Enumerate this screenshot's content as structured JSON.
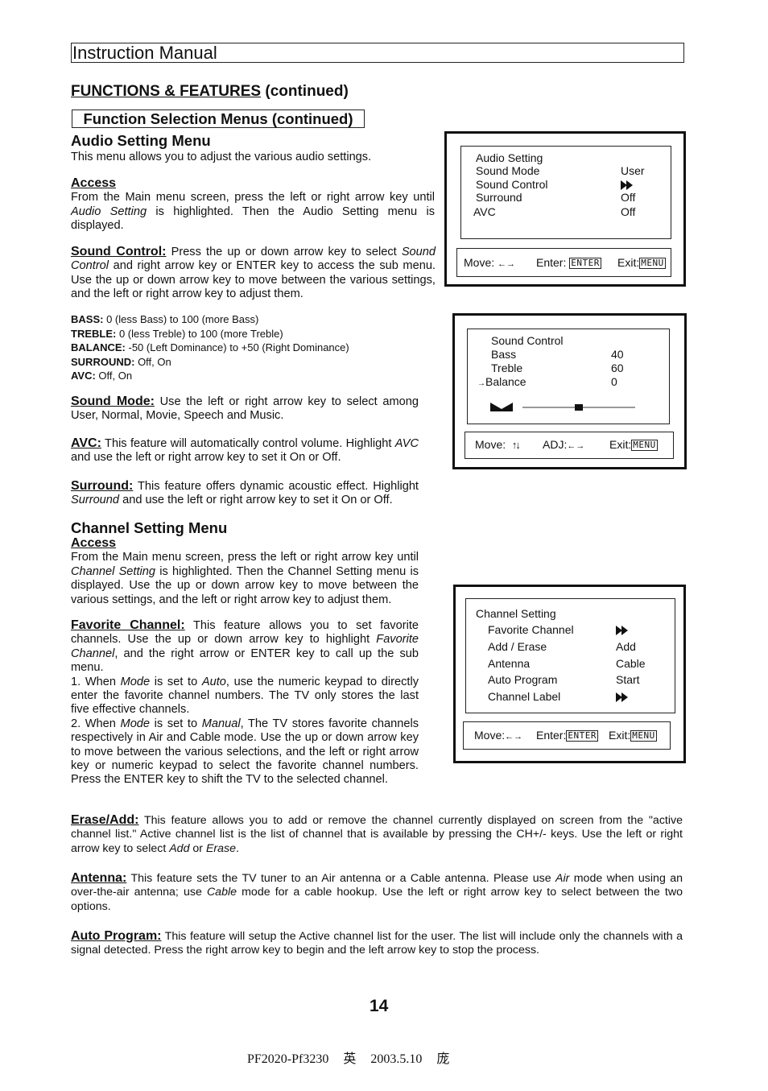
{
  "header": {
    "title": "Instruction Manual"
  },
  "section": {
    "title_underlined": "FUNCTIONS & FEATURES",
    "title_suffix": " (continued)",
    "subtitle": "Function Selection Menus (continued)"
  },
  "audio": {
    "heading": "Audio Setting Menu",
    "intro": "This menu allows you to adjust the various audio settings.",
    "access_label": "Access",
    "access_p1": "From the Main menu screen, press the left or right arrow key until ",
    "access_i1": "Audio Setting",
    "access_p2": " is highlighted. Then the Audio Setting menu is displayed.",
    "sound_control_label": "Sound Control:",
    "sound_control_p1": " Press the up or down arrow key to select ",
    "sound_control_i1": "Sound Control",
    "sound_control_p2": " and right arrow key or ENTER key to access the sub menu. Use the up or down arrow key to move between the various settings, and the left or right arrow key to adjust them.",
    "specs": [
      {
        "key": "BASS:",
        "value": " 0 (less Bass) to 100 (more Bass)"
      },
      {
        "key": "TREBLE:",
        "value": " 0 (less Treble) to 100 (more Treble)"
      },
      {
        "key": "BALANCE:",
        "value": " -50 (Left Dominance) to +50 (Right Dominance)"
      },
      {
        "key": "SURROUND:",
        "value": " Off, On"
      },
      {
        "key": "AVC:",
        "value": " Off, On"
      }
    ],
    "sound_mode_label": "Sound Mode:",
    "sound_mode_text": " Use the left or right arrow key to select among User, Normal, Movie, Speech and Music.",
    "avc_label": "AVC:",
    "avc_p1": " This feature will automatically control volume. Highlight ",
    "avc_i1": "AVC",
    "avc_p2": " and use the left or right arrow key to set it On or Off.",
    "surround_label": "Surround:",
    "surround_p1": " This feature offers dynamic acoustic effect. Highlight ",
    "surround_i1": "Surround",
    "surround_p2": " and use the left or right arrow key to set it On or Off."
  },
  "channel": {
    "heading": "Channel Setting Menu",
    "access_label": "Access",
    "access_p1": "From the Main menu screen, press the left or right arrow key until ",
    "access_i1": "Channel Setting",
    "access_p2": " is highlighted. Then the Channel Setting menu is displayed. Use the up or down arrow key to move between the various settings, and the left or right arrow key to adjust them.",
    "fav_label": "Favorite Channel",
    "fav_colon": ":",
    "fav_p1": " This feature allows you to set favorite channels. Use the up or down arrow key to highlight ",
    "fav_i1": "Favorite Channel",
    "fav_p2": ", and the right arrow or ENTER key to call up the sub menu.",
    "fav_n1_a": "1. When ",
    "fav_n1_i1": "Mode",
    "fav_n1_b": " is set to ",
    "fav_n1_i2": "Auto",
    "fav_n1_c": ", use the numeric keypad to directly enter the favorite channel numbers. The TV only stores the last five effective channels.",
    "fav_n2_a": "2. When ",
    "fav_n2_i1": "Mode",
    "fav_n2_b": " is set to ",
    "fav_n2_i2": "Manual",
    "fav_n2_c": ", The TV stores favorite channels respectively in Air and Cable mode. Use the up or down arrow key to move between the various selections, and the left or right arrow key or numeric keypad to select the favorite channel numbers. Press the ENTER key to shift the TV to the selected channel.",
    "erase_label": "Erase/Add:",
    "erase_p1": " This feature allows you to add or remove the channel currently displayed on screen from the \"active channel list.\" Active channel list is the list of channel that is available by pressing the CH+/- keys. Use the left or right arrow key to select ",
    "erase_i1": "Add",
    "erase_p2": " or ",
    "erase_i2": "Erase",
    "erase_p3": ".",
    "antenna_label": "Antenna:",
    "antenna_p1": " This feature sets the TV tuner to an Air antenna or a Cable antenna. Please use ",
    "antenna_i1": "Air",
    "antenna_p2": " mode when using an over-the-air antenna; use ",
    "antenna_i2": "Cable",
    "antenna_p3": " mode for a cable hookup. Use the left or right arrow key to select between the two options.",
    "auto_label": "Auto Program:",
    "auto_text": " This feature will setup the Active channel list for the user. The list will include only the channels with a signal detected. Press the right arrow key to begin and the left arrow key to stop the process."
  },
  "osd_audio": {
    "title": "Audio Setting",
    "rows": [
      {
        "label": "Sound Mode",
        "value": "User"
      },
      {
        "label": "Sound Control",
        "value": "submenu-arrow-icon"
      },
      {
        "label": "Surround",
        "value": "Off"
      },
      {
        "label": "AVC",
        "value": "Off"
      }
    ],
    "footer": {
      "move": "Move:",
      "move_arrows": "←→",
      "enter": "Enter:",
      "enter_key": "ENTER",
      "exit": "Exit:",
      "exit_key": "MENU"
    }
  },
  "osd_sound": {
    "title": "Sound Control",
    "rows": [
      {
        "label": "Bass",
        "value": "40"
      },
      {
        "label": "Treble",
        "value": "60"
      },
      {
        "label": "Balance",
        "value": "0",
        "selected": true
      }
    ],
    "selector": "→",
    "balance_slider": {
      "min": -50,
      "max": 50,
      "value": 0
    },
    "footer": {
      "move": "Move:",
      "move_arrows": "↑↓",
      "adj": "ADJ:",
      "adj_arrows": "←→",
      "exit": "Exit:",
      "exit_key": "MENU"
    }
  },
  "osd_channel": {
    "title": "Channel Setting",
    "rows": [
      {
        "label": "Favorite Channel",
        "value": "submenu-arrow-icon"
      },
      {
        "label": "Add / Erase",
        "value": "Add"
      },
      {
        "label": "Antenna",
        "value": "Cable"
      },
      {
        "label": "Auto Program",
        "value": "Start"
      },
      {
        "label": "Channel Label",
        "value": "submenu-arrow-icon"
      }
    ],
    "footer": {
      "move": "Move:",
      "move_arrows": "←→",
      "enter": "Enter:",
      "enter_key": "ENTER",
      "exit": "Exit:",
      "exit_key": "MENU"
    }
  },
  "page": {
    "number": "14",
    "footer_code": "PF2020-Pf3230",
    "footer_lang": "英",
    "footer_date": "2003.5.10",
    "footer_author": "庞"
  }
}
